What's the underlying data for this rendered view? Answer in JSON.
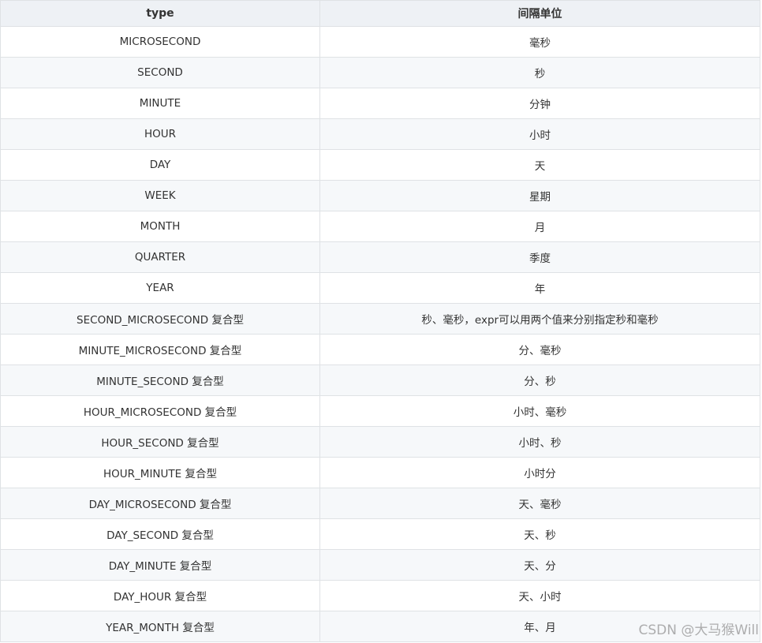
{
  "table": {
    "headers": [
      "type",
      "间隔单位"
    ],
    "rows": [
      [
        "MICROSECOND",
        "毫秒"
      ],
      [
        "SECOND",
        "秒"
      ],
      [
        "MINUTE",
        "分钟"
      ],
      [
        "HOUR",
        "小时"
      ],
      [
        "DAY",
        "天"
      ],
      [
        "WEEK",
        "星期"
      ],
      [
        "MONTH",
        "月"
      ],
      [
        "QUARTER",
        "季度"
      ],
      [
        "YEAR",
        "年"
      ],
      [
        "SECOND_MICROSECOND 复合型",
        "秒、毫秒，expr可以用两个值来分别指定秒和毫秒"
      ],
      [
        "MINUTE_MICROSECOND 复合型",
        "分、毫秒"
      ],
      [
        "MINUTE_SECOND 复合型",
        "分、秒"
      ],
      [
        "HOUR_MICROSECOND 复合型",
        "小时、毫秒"
      ],
      [
        "HOUR_SECOND 复合型",
        "小时、秒"
      ],
      [
        "HOUR_MINUTE 复合型",
        "小时分"
      ],
      [
        "DAY_MICROSECOND 复合型",
        "天、毫秒"
      ],
      [
        "DAY_SECOND 复合型",
        "天、秒"
      ],
      [
        "DAY_MINUTE 复合型",
        "天、分"
      ],
      [
        "DAY_HOUR 复合型",
        "天、小时"
      ],
      [
        "YEAR_MONTH 复合型",
        "年、月"
      ]
    ]
  },
  "watermark": {
    "text": "CSDN @大马猴Will"
  },
  "colors": {
    "header_bg": "#eef1f5",
    "stripe_bg": "#f6f8fa",
    "border": "#dfe2e5",
    "text": "#333333"
  }
}
